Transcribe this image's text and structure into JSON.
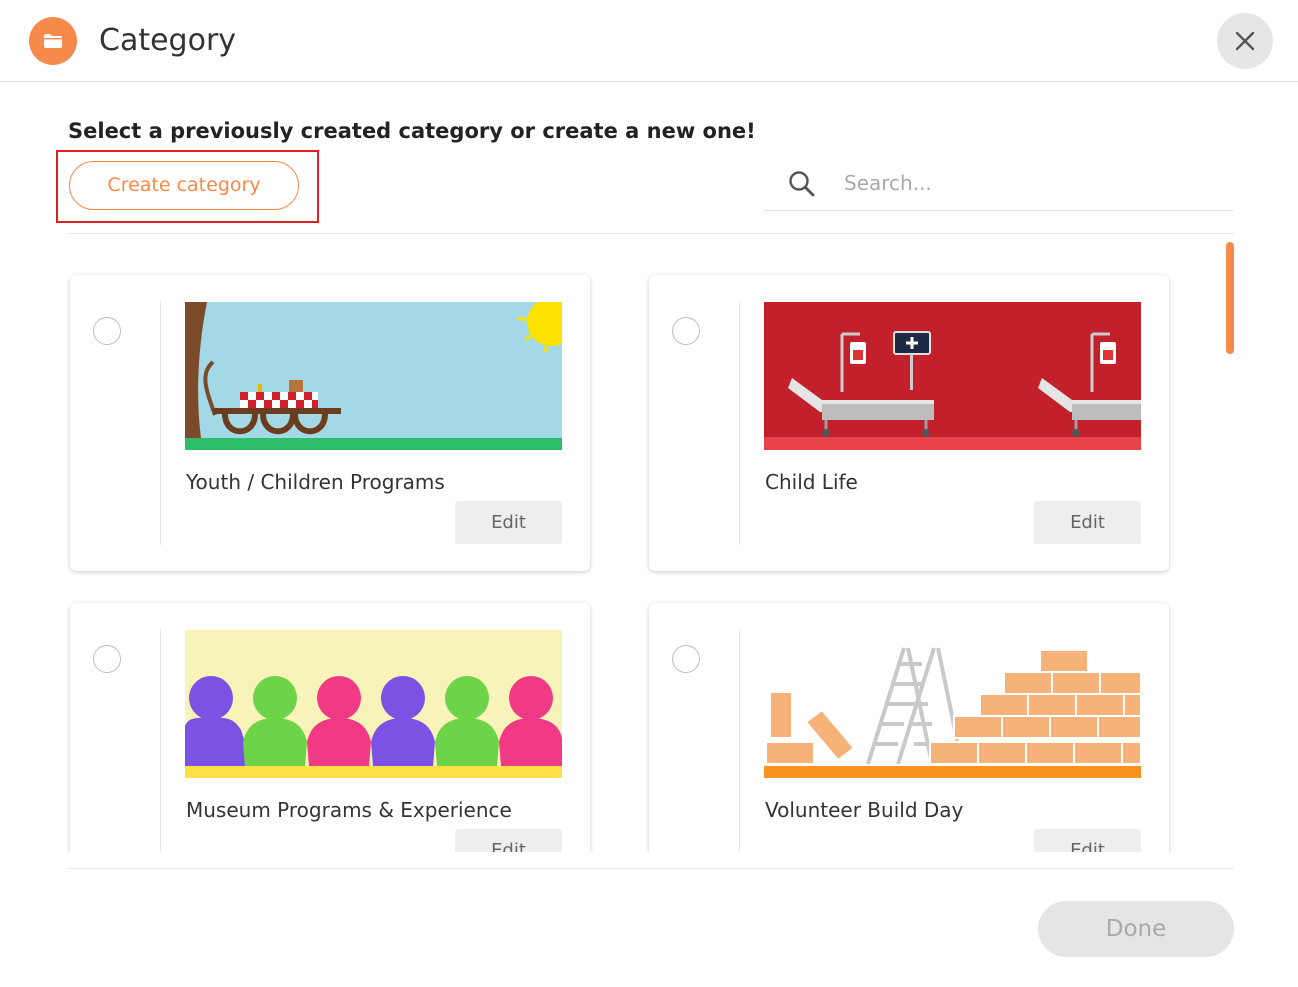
{
  "header": {
    "title": "Category",
    "icon": "folder-icon",
    "close_icon": "close-icon"
  },
  "instruction": "Select a previously created category or create a new one!",
  "create_button_label": "Create category",
  "search": {
    "placeholder": "Search...",
    "value": ""
  },
  "categories": [
    {
      "name": "Youth / Children Programs",
      "image": "picnic-illustration",
      "edit_label": "Edit"
    },
    {
      "name": "Child Life",
      "image": "hospital-bed-illustration",
      "edit_label": "Edit"
    },
    {
      "name": "Museum Programs & Experience",
      "image": "people-chain-illustration",
      "edit_label": "Edit"
    },
    {
      "name": "Volunteer Build Day",
      "image": "brick-wall-illustration",
      "edit_label": "Edit"
    }
  ],
  "done_label": "Done",
  "colors": {
    "accent": "#f58a4b",
    "highlight": "#e0201f",
    "disabled_bg": "#e5e5e5",
    "disabled_text": "#a9a9a9"
  }
}
